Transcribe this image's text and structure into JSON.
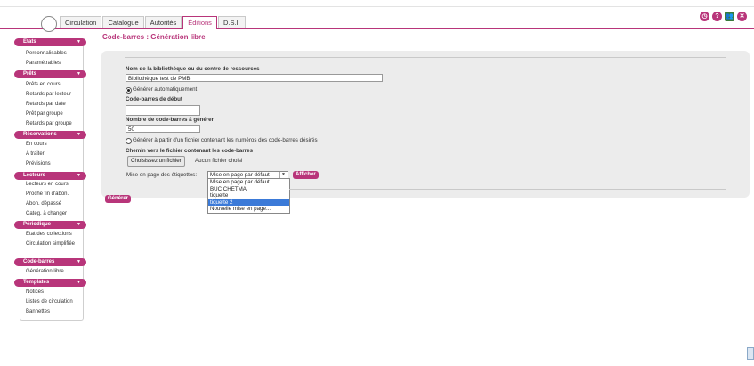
{
  "header": {
    "tabs": [
      {
        "label": "Circulation"
      },
      {
        "label": "Catalogue"
      },
      {
        "label": "Autorités"
      },
      {
        "label": "Éditions",
        "active": true
      },
      {
        "label": "D.S.I."
      }
    ],
    "icons": [
      "history-icon",
      "help-icon",
      "user-group-icon",
      "close-icon"
    ]
  },
  "sidebar": {
    "sections": [
      {
        "title": "Etats",
        "items": [
          "Personnalisables",
          "Paramétrables"
        ]
      },
      {
        "title": "Prêts",
        "items": [
          "Prêts en cours",
          "Retards par lecteur",
          "Retards par date",
          "Prêt par groupe",
          "Retards par groupe"
        ]
      },
      {
        "title": "Réservations",
        "items": [
          "En cours",
          "A traiter",
          "Prévisions"
        ]
      },
      {
        "title": "Lecteurs",
        "items": [
          "Lecteurs en cours",
          "Proche fin d'abon.",
          "Abon. dépassé",
          "Categ. à changer"
        ]
      },
      {
        "title": "Périodique",
        "items": [
          "Etat des collections",
          "Circulation simplifiée"
        ]
      },
      {
        "title": "Code-barres",
        "items": [
          "Génération libre"
        ]
      },
      {
        "title": "Templates",
        "items": [
          "Notices",
          "Listes de circulation",
          "Bannettes"
        ]
      }
    ]
  },
  "main": {
    "title": "Code-barres : Génération libre",
    "library_label": "Nom de la bibliothèque ou du centre de ressources",
    "library_value": "Bibliothèque test de PMB",
    "radio_auto_label": "Générer automatiquement",
    "start_label": "Code-barres de début",
    "start_value": "",
    "count_label": "Nombre de code-barres à générer",
    "count_value": "50",
    "radio_file_label": "Générer à partir d'un fichier contenant les numéros des code-barres désirés",
    "file_path_label": "Chemin vers le fichier contenant les code-barres",
    "file_button": "Choisissez un fichier",
    "file_none": "Aucun fichier choisi",
    "layout_label": "Mise en page des étiquettes:",
    "layout_selected": "Mise en page par défaut",
    "layout_options": [
      "Mise en page par défaut",
      "BUC CHETMA",
      "tiquette",
      "tiquette 2",
      "Nouvelle mise en page..."
    ],
    "layout_highlighted_index": 3,
    "show_button": "Afficher",
    "generate_button": "Générer"
  },
  "colors": {
    "accent": "#b8357a",
    "panel": "#ececec",
    "highlight": "#3b7ad8"
  }
}
